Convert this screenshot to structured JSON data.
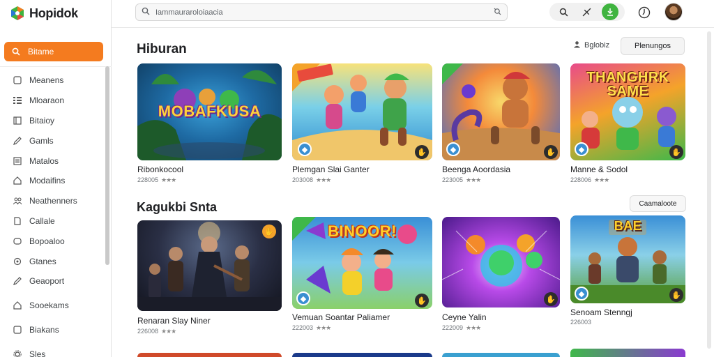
{
  "app": {
    "name": "Hopidok"
  },
  "search": {
    "value": "Iammauraroloiaacia"
  },
  "sidebar": {
    "active": {
      "label": "Bitame"
    },
    "items": [
      {
        "label": "Meanens",
        "icon": "square-icon"
      },
      {
        "label": "Mloaraon",
        "icon": "grid-icon"
      },
      {
        "label": "Bitaioy",
        "icon": "book-icon"
      },
      {
        "label": "Gamls",
        "icon": "pen-icon"
      },
      {
        "label": "Matalos",
        "icon": "list-icon"
      },
      {
        "label": "Modaifins",
        "icon": "home-icon"
      },
      {
        "label": "Neathenners",
        "icon": "people-icon"
      },
      {
        "label": "Callale",
        "icon": "doc-icon"
      },
      {
        "label": "Bopoaloo",
        "icon": "tag-icon"
      },
      {
        "label": "Gtanes",
        "icon": "circle-icon"
      },
      {
        "label": "Geaoport",
        "icon": "pen-icon"
      },
      {
        "label": "Sooekams",
        "icon": "home-icon"
      },
      {
        "label": "Biakans",
        "icon": "square-icon"
      },
      {
        "label": "Sles",
        "icon": "settings-icon"
      }
    ]
  },
  "sections": [
    {
      "title": "Hiburan",
      "action_link": "Bglobiz",
      "action_button": "Plenungos",
      "cards": [
        {
          "thumb_text": "MOBAFKUSA",
          "title": "Ribonkocool",
          "meta": "228005",
          "stars": "★★★"
        },
        {
          "thumb_text": "",
          "title": "Plemgan Slai Ganter",
          "meta": "203008",
          "stars": "★★★"
        },
        {
          "thumb_text": "",
          "title": "Beenga Aoordasia",
          "meta": "223005",
          "stars": "★★★"
        },
        {
          "thumb_text": "THANGHRK SAME",
          "title": "Manne & Sodol",
          "meta": "228006",
          "stars": "★★★"
        }
      ]
    },
    {
      "title": "Kagukbi Snta",
      "action_button": "Caamaloote",
      "cards": [
        {
          "thumb_text": "",
          "title": "Renaran Slay Niner",
          "meta": "226008",
          "stars": "★★★"
        },
        {
          "thumb_text": "BINOOR!",
          "title": "Vemuan Soantar Paliamer",
          "meta": "222003",
          "stars": "★★★"
        },
        {
          "thumb_text": "",
          "title": "Ceyne Yalin",
          "meta": "222009",
          "stars": "★★★"
        },
        {
          "thumb_text": "BAE",
          "title": "Senoam Stenngj",
          "meta": "226003",
          "stars": ""
        }
      ]
    }
  ],
  "colors": {
    "accent": "#f47b1f",
    "green": "#3fb43f"
  }
}
